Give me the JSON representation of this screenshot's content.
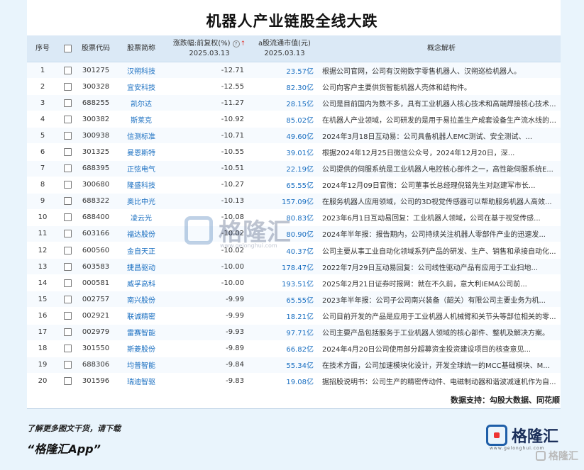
{
  "title": "机器人产业链股全线大跌",
  "headers": {
    "idx": "序号",
    "code": "股票代码",
    "name": "股票简称",
    "chg_line1": "涨跌幅:前复权(%)",
    "chg_line2": "2025.03.13",
    "cap_line1": "a股流通市值(元)",
    "cap_line2": "2025.03.13",
    "desc": "概念解析"
  },
  "rows": [
    {
      "idx": "1",
      "code": "301275",
      "name": "汉朔科技",
      "chg": "-12.71",
      "cap": "23.57亿",
      "desc": "根据公司官网，公司有汉朔数字零售机器人、汉朔巡检机器人。"
    },
    {
      "idx": "2",
      "code": "300328",
      "name": "宜安科技",
      "chg": "-12.55",
      "cap": "82.30亿",
      "desc": "公司向客户主要供货智能机器人壳体和结构件。"
    },
    {
      "idx": "3",
      "code": "688255",
      "name": "凯尔达",
      "chg": "-11.27",
      "cap": "28.15亿",
      "desc": "公司是目前国内为数不多，具有工业机器人核心技术和高端焊接核心技术..."
    },
    {
      "idx": "4",
      "code": "300382",
      "name": "斯莱克",
      "chg": "-10.92",
      "cap": "85.02亿",
      "desc": "在机器人产业领域，公司研发的是用于易拉盖生产成套设备生产流水线的堆..."
    },
    {
      "idx": "5",
      "code": "300938",
      "name": "信测标准",
      "chg": "-10.71",
      "cap": "49.60亿",
      "desc": "2024年3月18日互动易：公司具备机器人EMC测试、安全测试、..."
    },
    {
      "idx": "6",
      "code": "301325",
      "name": "曼恩斯特",
      "chg": "-10.55",
      "cap": "39.01亿",
      "desc": "根据2024年12月25日微信公众号，2024年12月20日，深..."
    },
    {
      "idx": "7",
      "code": "688395",
      "name": "正弦电气",
      "chg": "-10.51",
      "cap": "22.19亿",
      "desc": "公司提供的伺服系统是工业机器人电控核心部件之一，高性能伺服系统E..."
    },
    {
      "idx": "8",
      "code": "300680",
      "name": "隆盛科技",
      "chg": "-10.27",
      "cap": "65.55亿",
      "desc": "2024年12月09日官微：公司董事长总经理倪铭先生对赵建军市长..."
    },
    {
      "idx": "9",
      "code": "688322",
      "name": "奥比中光",
      "chg": "-10.13",
      "cap": "157.09亿",
      "desc": "在服务机器人应用领域，公司的3D视觉传感器可以帮助服务机器人高效..."
    },
    {
      "idx": "10",
      "code": "688400",
      "name": "凌云光",
      "chg": "-10.08",
      "cap": "80.83亿",
      "desc": "2023年6月1日互动易回复：工业机器人领域，公司在基于视觉传感..."
    },
    {
      "idx": "11",
      "code": "603166",
      "name": "福达股份",
      "chg": "-10.02",
      "cap": "80.90亿",
      "desc": "2024年半年报：报告期内，公司持续关注机器人零部件产业的迅速发..."
    },
    {
      "idx": "12",
      "code": "600560",
      "name": "金自天正",
      "chg": "-10.02",
      "cap": "40.37亿",
      "desc": "公司主要从事工业自动化领域系列产品的研发、生产、销售和承接自动化..."
    },
    {
      "idx": "13",
      "code": "603583",
      "name": "捷昌驱动",
      "chg": "-10.00",
      "cap": "178.47亿",
      "desc": "2022年7月29日互动易回复：公司线性驱动产品有应用于工业扫地..."
    },
    {
      "idx": "14",
      "code": "000581",
      "name": "威孚高科",
      "chg": "-10.00",
      "cap": "193.51亿",
      "desc": "2025年2月21日证券时报网：就在不久前，意大利IEMA公司前..."
    },
    {
      "idx": "15",
      "code": "002757",
      "name": "南兴股份",
      "chg": "-9.99",
      "cap": "65.55亿",
      "desc": "2023年半年报：公司子公司南兴装备（韶关）有限公司主要业务为机..."
    },
    {
      "idx": "16",
      "code": "002921",
      "name": "联诚精密",
      "chg": "-9.99",
      "cap": "18.21亿",
      "desc": "公司目前开发的产品是应用于工业机器人机械臂和关节头等部位相关的零..."
    },
    {
      "idx": "17",
      "code": "002979",
      "name": "雷赛智能",
      "chg": "-9.93",
      "cap": "97.71亿",
      "desc": "公司主要产品包括服务于工业机器人领域的核心部件、整机及解决方案。"
    },
    {
      "idx": "18",
      "code": "301550",
      "name": "斯菱股份",
      "chg": "-9.89",
      "cap": "66.82亿",
      "desc": "2024年4月20日公司使用部分超募资金投资建设项目的核查意见..."
    },
    {
      "idx": "19",
      "code": "688306",
      "name": "均普智能",
      "chg": "-9.84",
      "cap": "55.34亿",
      "desc": "在技术方面，公司加速模块化设计，开发全球统一的MCC基础模块、M..."
    },
    {
      "idx": "20",
      "code": "301596",
      "name": "瑞迪智驱",
      "chg": "-9.83",
      "cap": "19.08亿",
      "desc": "据招股说明书：公司生产的精密传动件、电磁制动器和谐波减速机作为自..."
    }
  ],
  "source": "数据支持：勾股大数据、同花顺",
  "promo_line1": "了解更多图文干货，请下载",
  "promo_line2": "“格隆汇App”",
  "logo_text": "格隆汇",
  "logo_sub": "www.gelonghui.com",
  "watermark_br": "格隆汇",
  "center_watermark": "格隆汇",
  "center_watermark_url": "www.gelonghui.com",
  "colors": {
    "accent": "#1a6fc1",
    "header_bg": "#dbe9f6",
    "page_bg": "#e9f4fc"
  },
  "icons": {
    "help": "help-circle-icon",
    "sort": "sort-arrow-icon"
  }
}
